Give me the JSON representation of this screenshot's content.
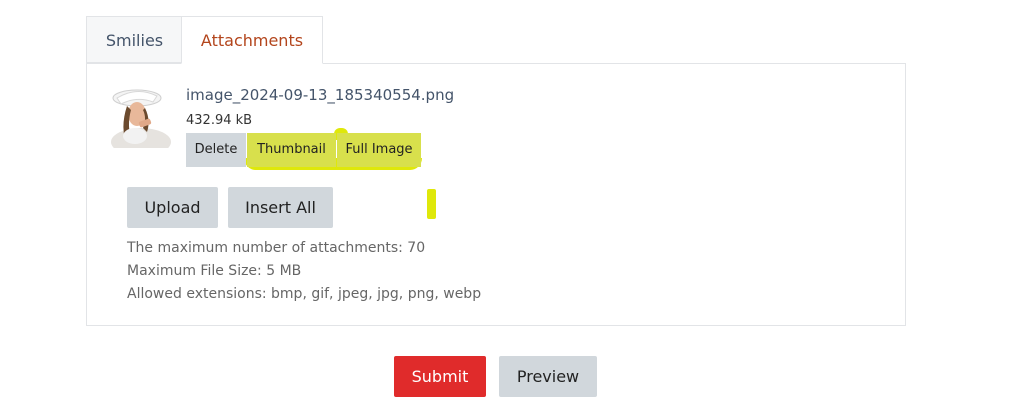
{
  "tabs": {
    "smilies_label": "Smilies",
    "attachments_label": "Attachments",
    "active": "Attachments"
  },
  "attachment": {
    "file_name": "image_2024-09-13_185340554.png",
    "file_size": "432.94 kB",
    "delete_label": "Delete",
    "thumbnail_label": "Thumbnail",
    "full_image_label": "Full Image"
  },
  "actions": {
    "upload_label": "Upload",
    "insert_all_label": "Insert All"
  },
  "info": {
    "max_attachments": "The maximum number of attachments: 70",
    "max_file_size": "Maximum File Size: 5 MB",
    "allowed_extensions": "Allowed extensions: bmp, gif, jpeg, jpg, png, webp"
  },
  "form": {
    "submit_label": "Submit",
    "preview_label": "Preview"
  },
  "colors": {
    "accent": "#e02b2b",
    "active_tab_text": "#b3451c",
    "highlight": "#dfe80a",
    "button_gray": "#d1d7dc"
  }
}
